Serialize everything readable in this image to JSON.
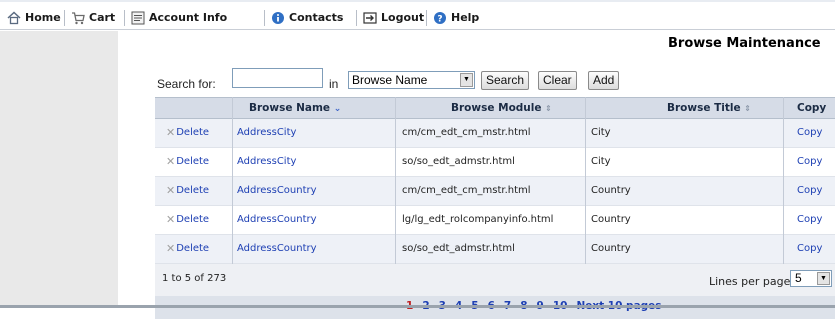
{
  "menu": [
    {
      "label": "Home",
      "icon": "home-icon"
    },
    {
      "label": "Cart",
      "icon": "cart-icon"
    },
    {
      "label": "Account Info",
      "icon": "account-icon"
    },
    {
      "label": "Contacts",
      "icon": "contacts-icon"
    },
    {
      "label": "Logout",
      "icon": "logout-icon"
    },
    {
      "label": "Help",
      "icon": "help-icon"
    }
  ],
  "page_title": "Browse Maintenance",
  "search": {
    "label": "Search for:",
    "value": "",
    "in_label": "in",
    "field_selected": "Browse Name",
    "search_btn": "Search",
    "clear_btn": "Clear",
    "add_btn": "Add"
  },
  "table": {
    "columns": [
      "",
      "Browse Name",
      "Browse Module",
      "Browse Title",
      "Copy"
    ],
    "rows": [
      {
        "action": "Delete",
        "name": "AddressCity",
        "module": "cm/cm_edt_cm_mstr.html",
        "title": "City",
        "copy": "Copy"
      },
      {
        "action": "Delete",
        "name": "AddressCity",
        "module": "so/so_edt_admstr.html",
        "title": "City",
        "copy": "Copy"
      },
      {
        "action": "Delete",
        "name": "AddressCountry",
        "module": "cm/cm_edt_cm_mstr.html",
        "title": "Country",
        "copy": "Copy"
      },
      {
        "action": "Delete",
        "name": "AddressCountry",
        "module": "lg/lg_edt_rolcompanyinfo.html",
        "title": "Country",
        "copy": "Copy"
      },
      {
        "action": "Delete",
        "name": "AddressCountry",
        "module": "so/so_edt_admstr.html",
        "title": "Country",
        "copy": "Copy"
      }
    ]
  },
  "footer": {
    "range": "1 to 5 of 273",
    "lines_label": "Lines per page:",
    "lines_value": "5"
  },
  "pager": {
    "pages": [
      "1",
      "2",
      "3",
      "4",
      "5",
      "6",
      "7",
      "8",
      "9",
      "10"
    ],
    "current": "1",
    "next": "Next 10 pages"
  },
  "colors": {
    "accent": "#1d3fb3",
    "current_page": "#c02020",
    "header_bg": "#d6dce7"
  }
}
